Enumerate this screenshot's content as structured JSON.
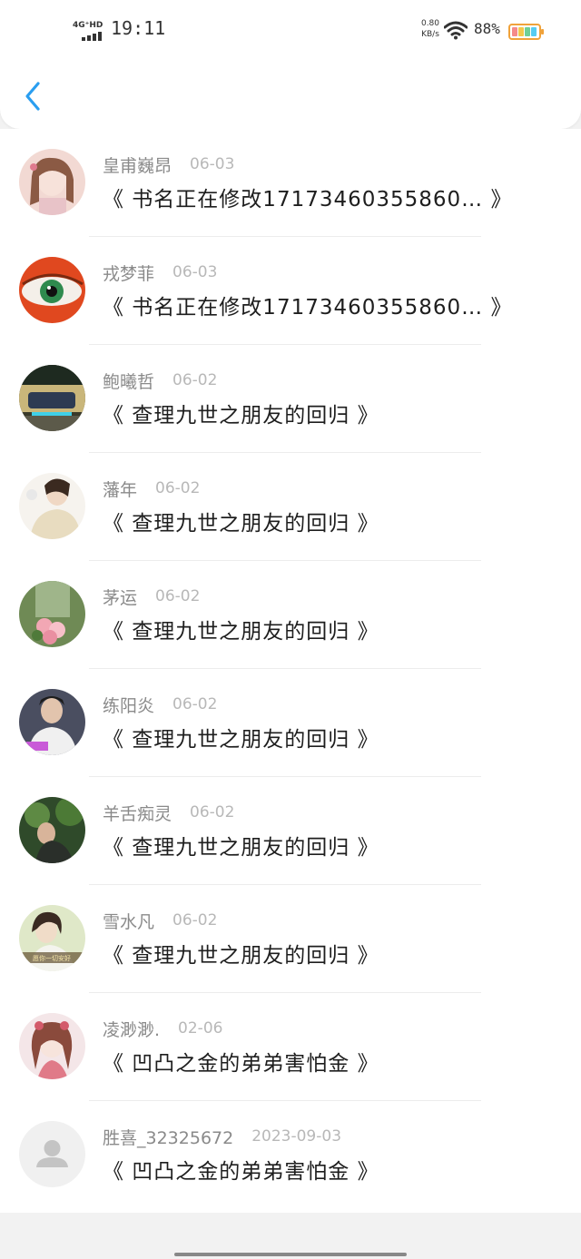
{
  "status_bar": {
    "network": "4G⁺HD",
    "time": "19:11",
    "net_speed_value": "0.80",
    "net_speed_unit": "KB/s",
    "battery": "88%",
    "battery_level": 0.88
  },
  "header": {
    "back_icon": "chevron-left-icon",
    "accent": "#2a9ef0"
  },
  "messages": [
    {
      "name": "皇甫巍昂",
      "date": "06-03",
      "book": "《 书名正在修改17173460355860… 》",
      "avatar": "avatar-photo"
    },
    {
      "name": "戎梦菲",
      "date": "06-03",
      "book": "《 书名正在修改17173460355860… 》",
      "avatar": "avatar-photo"
    },
    {
      "name": "鲍曦哲",
      "date": "06-02",
      "book": "《 查理九世之朋友的回归 》",
      "avatar": "avatar-photo"
    },
    {
      "name": "藩年",
      "date": "06-02",
      "book": "《 查理九世之朋友的回归 》",
      "avatar": "avatar-photo"
    },
    {
      "name": "茅运",
      "date": "06-02",
      "book": "《 查理九世之朋友的回归 》",
      "avatar": "avatar-photo"
    },
    {
      "name": "练阳炎",
      "date": "06-02",
      "book": "《 查理九世之朋友的回归 》",
      "avatar": "avatar-photo"
    },
    {
      "name": "羊舌痴灵",
      "date": "06-02",
      "book": "《 查理九世之朋友的回归 》",
      "avatar": "avatar-photo"
    },
    {
      "name": "雪水凡",
      "date": "06-02",
      "book": "《 查理九世之朋友的回归 》",
      "avatar": "avatar-photo",
      "avatar_caption": "愿你一切安好"
    },
    {
      "name": "凌渺渺.",
      "date": "02-06",
      "book": "《 凹凸之金的弟弟害怕金 》",
      "avatar": "avatar-photo"
    },
    {
      "name": "胜喜_32325672",
      "date": "2023-09-03",
      "book": "《 凹凸之金的弟弟害怕金 》",
      "avatar": "default-avatar-icon"
    }
  ]
}
